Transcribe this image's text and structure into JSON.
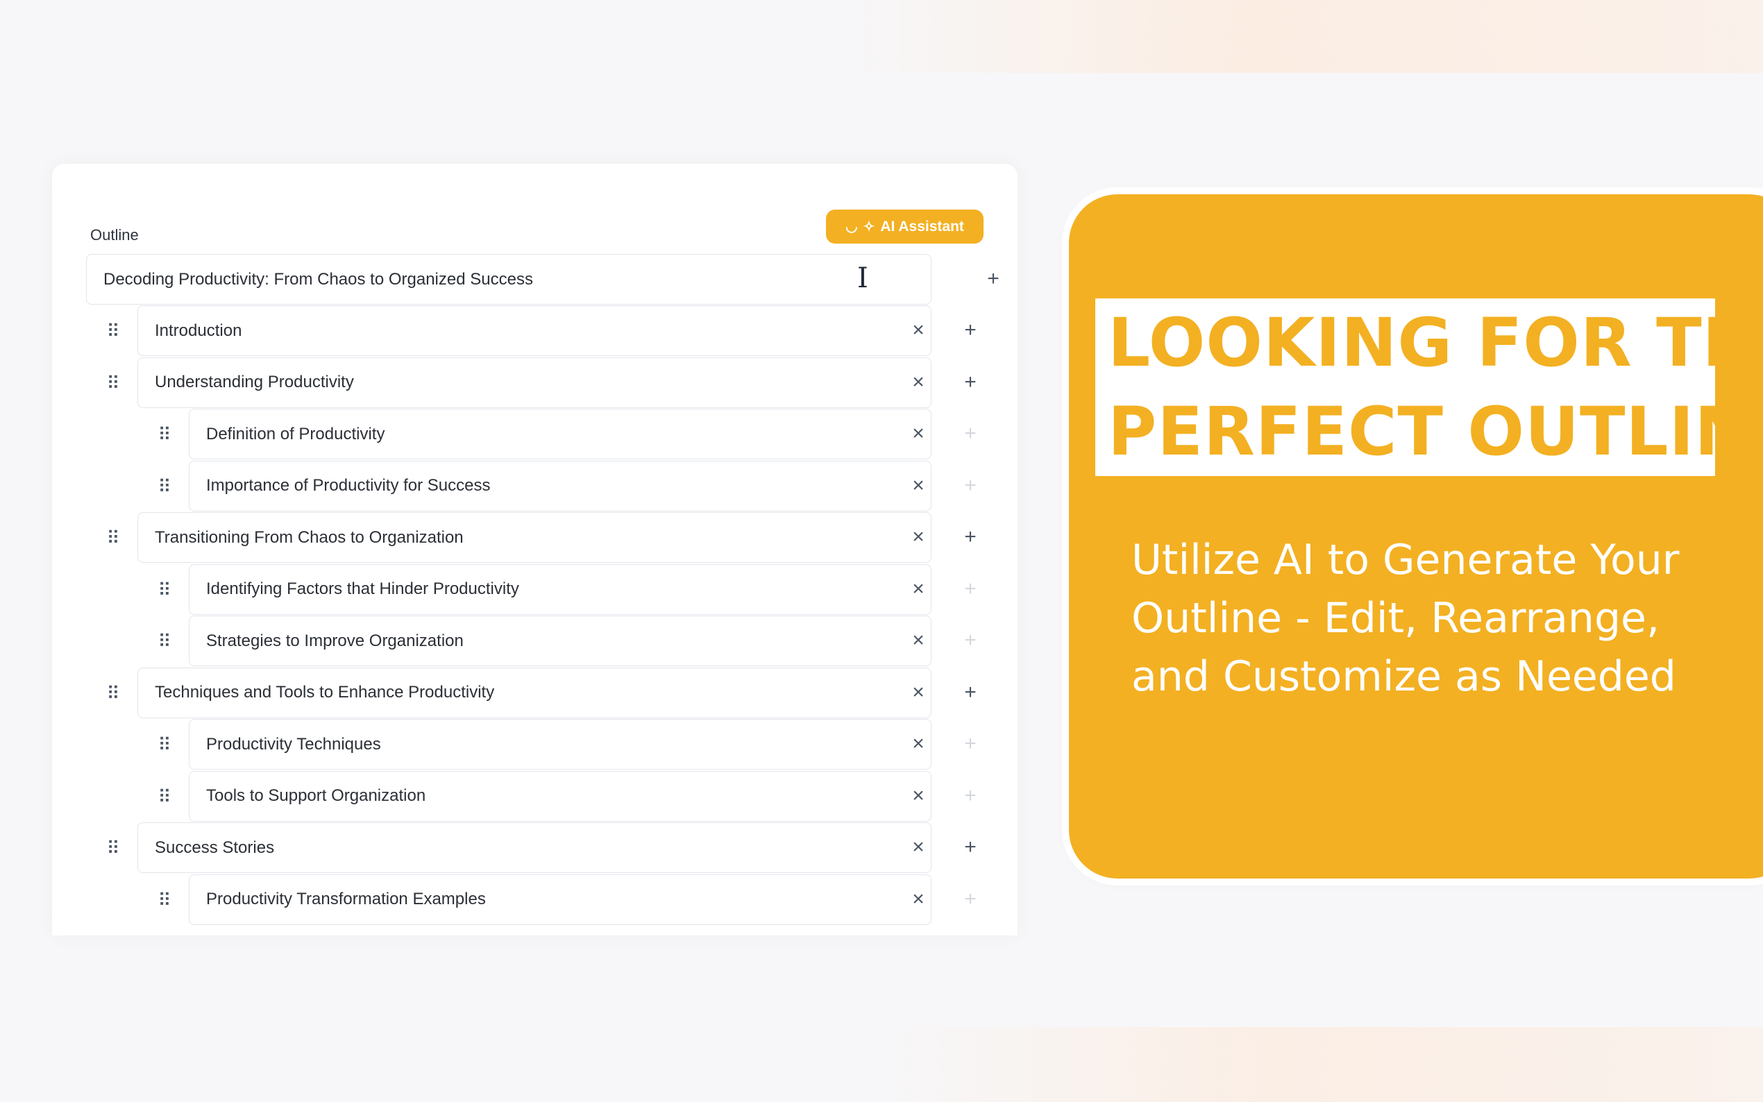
{
  "outline": {
    "label": "Outline",
    "ai_button": {
      "label": "AI Assistant",
      "icon": "sparkle-icon"
    },
    "title_value": "Decoding Productivity: From Chaos to Organized Success",
    "items": [
      {
        "level": 1,
        "text": "Introduction"
      },
      {
        "level": 1,
        "text": "Understanding Productivity"
      },
      {
        "level": 2,
        "text": "Definition of Productivity"
      },
      {
        "level": 2,
        "text": "Importance of Productivity for Success"
      },
      {
        "level": 1,
        "text": "Transitioning From Chaos to Organization"
      },
      {
        "level": 2,
        "text": "Identifying Factors that Hinder Productivity"
      },
      {
        "level": 2,
        "text": "Strategies to Improve Organization"
      },
      {
        "level": 1,
        "text": "Techniques and Tools to Enhance Productivity"
      },
      {
        "level": 2,
        "text": "Productivity Techniques"
      },
      {
        "level": 2,
        "text": "Tools to Support Organization"
      },
      {
        "level": 1,
        "text": "Success Stories"
      },
      {
        "level": 2,
        "text": "Productivity Transformation Examples"
      }
    ]
  },
  "promo": {
    "headline_line1": "LOOKING FOR THE",
    "headline_line2": "PERFECT OUTLINE?",
    "subtitle": "Utilize AI to Generate Your Outline - Edit, Rearrange, and Customize as Needed"
  },
  "colors": {
    "accent": "#f3b022",
    "background": "#f7f7f9",
    "text": "#2b2f36"
  }
}
